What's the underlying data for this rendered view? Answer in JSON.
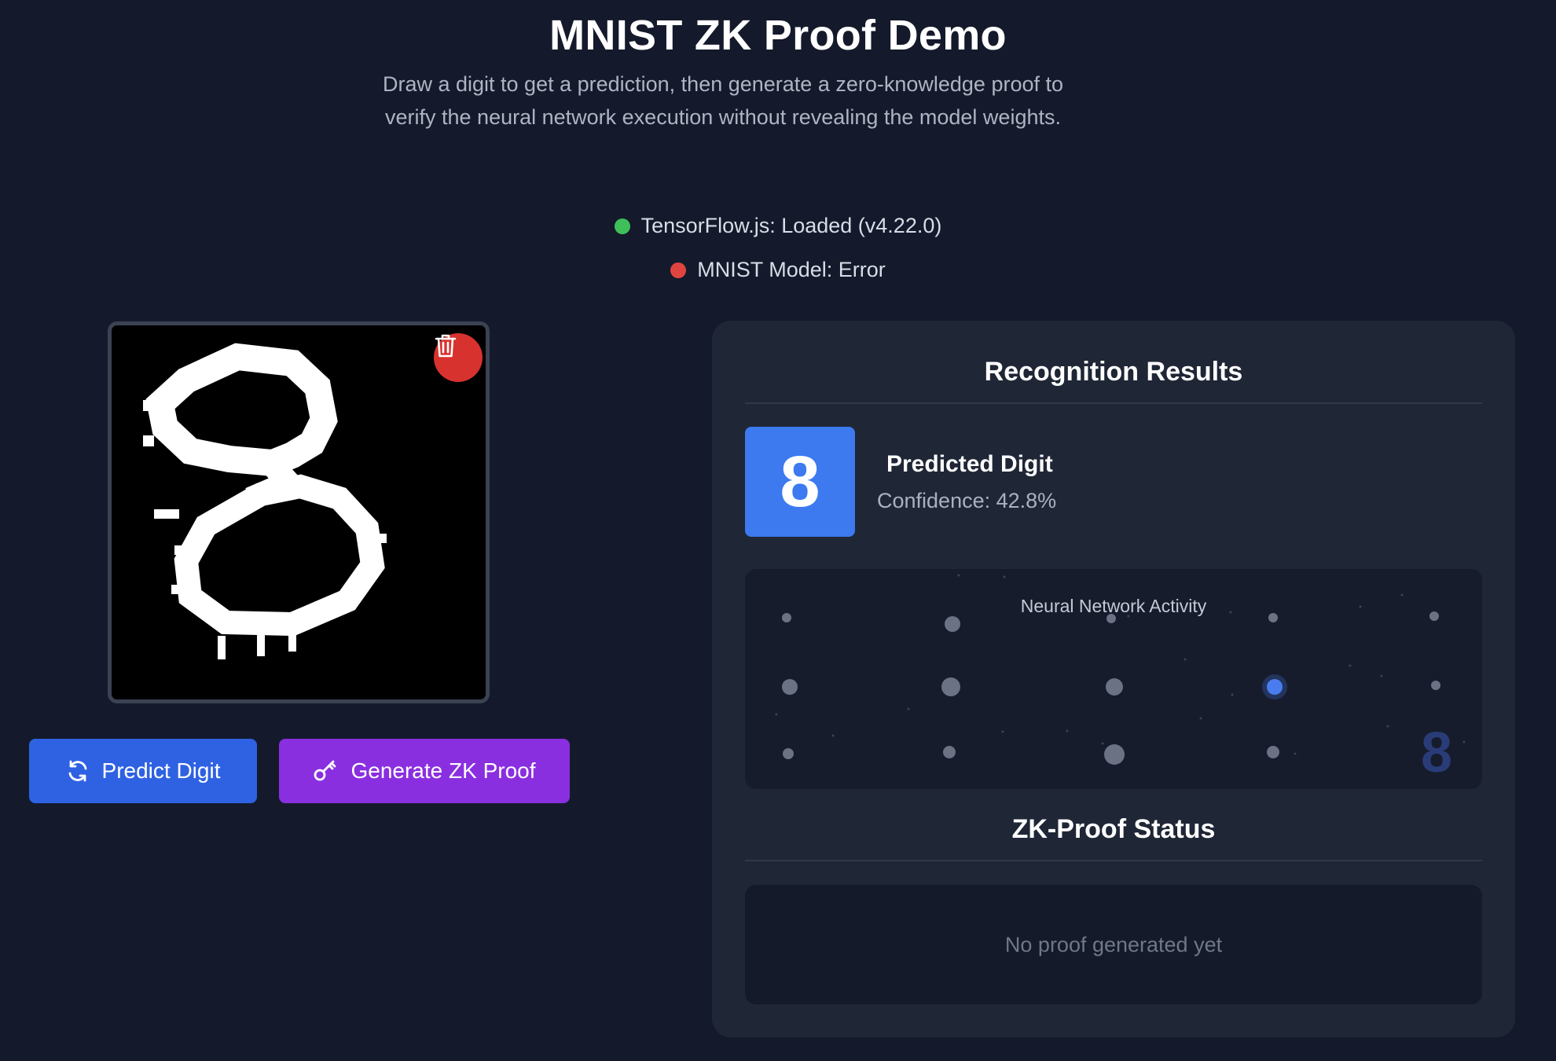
{
  "header": {
    "title": "MNIST ZK Proof Demo",
    "subtitle": "Draw a digit to get a prediction, then generate a zero-knowledge proof to verify the neural network execution without revealing the model weights."
  },
  "status": [
    {
      "text": "TensorFlow.js: Loaded (v4.22.0)",
      "color": "#3fbf5a",
      "state": "ok"
    },
    {
      "text": "MNIST Model: Error",
      "color": "#e0443f",
      "state": "error"
    }
  ],
  "canvas": {
    "clear_icon": "trash-icon"
  },
  "actions": {
    "predict_label": "Predict Digit",
    "predict_icon": "refresh-icon",
    "proof_label": "Generate ZK Proof",
    "proof_icon": "key-icon"
  },
  "results": {
    "heading": "Recognition Results",
    "digit": "8",
    "predicted_label": "Predicted Digit",
    "confidence_text": "Confidence: 42.8%",
    "confidence": 42.8
  },
  "network": {
    "title": "Neural Network Activity",
    "output_digit": "8",
    "active_color": "#4a7cf0"
  },
  "proof": {
    "heading": "ZK-Proof Status",
    "empty_text": "No proof generated yet"
  }
}
